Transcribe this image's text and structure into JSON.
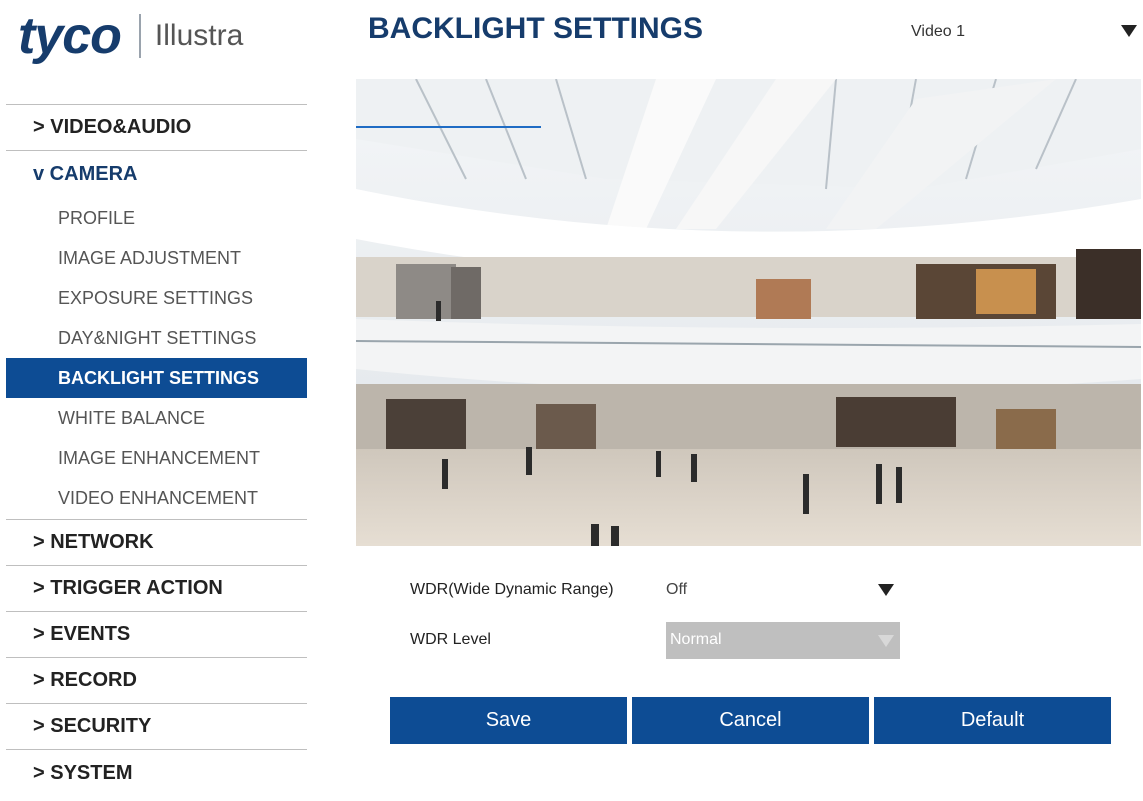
{
  "brand": {
    "primary": "tyco",
    "secondary": "Illustra",
    "color": "#163c6c"
  },
  "header": {
    "title": "BACKLIGHT SETTINGS",
    "video_select": {
      "value": "Video 1"
    }
  },
  "sidebar": {
    "sections": [
      {
        "label": "> VIDEO&AUDIO"
      },
      {
        "label": "v CAMERA",
        "items": [
          {
            "label": "PROFILE"
          },
          {
            "label": "IMAGE ADJUSTMENT"
          },
          {
            "label": "EXPOSURE SETTINGS"
          },
          {
            "label": "DAY&NIGHT SETTINGS"
          },
          {
            "label": "BACKLIGHT SETTINGS",
            "active": true
          },
          {
            "label": "WHITE BALANCE"
          },
          {
            "label": "IMAGE ENHANCEMENT"
          },
          {
            "label": "VIDEO ENHANCEMENT"
          }
        ]
      },
      {
        "label": "> NETWORK"
      },
      {
        "label": "> TRIGGER ACTION"
      },
      {
        "label": "> EVENTS"
      },
      {
        "label": "> RECORD"
      },
      {
        "label": "> SECURITY"
      },
      {
        "label": "> SYSTEM"
      }
    ]
  },
  "form": {
    "wdr": {
      "label": "WDR(Wide Dynamic Range)",
      "value": "Off"
    },
    "wdr_level": {
      "label": "WDR Level",
      "value": "Normal",
      "disabled": true
    }
  },
  "buttons": {
    "save": "Save",
    "cancel": "Cancel",
    "default": "Default"
  },
  "colors": {
    "accent": "#0d4c94",
    "title": "#163c6c",
    "disabled": "#bfbfbf"
  }
}
